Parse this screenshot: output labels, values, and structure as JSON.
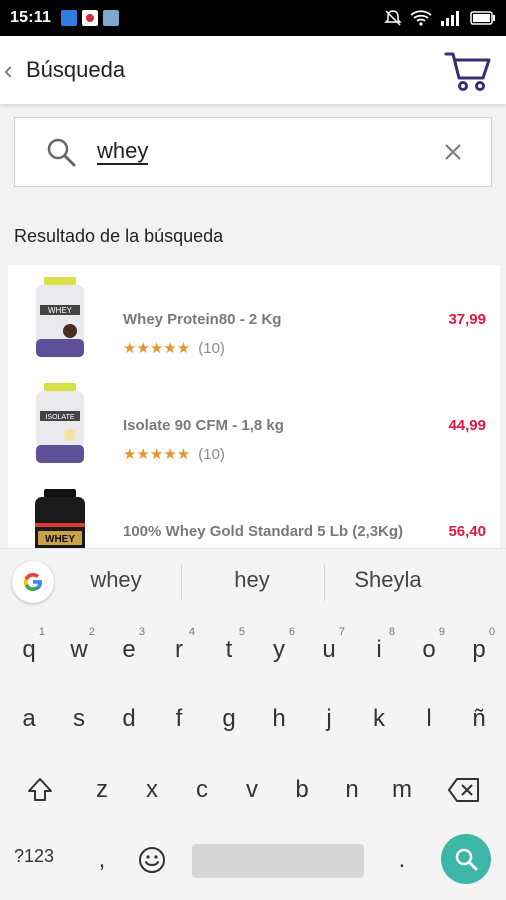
{
  "status_bar": {
    "time": "15:11"
  },
  "header": {
    "title": "Búsqueda"
  },
  "search": {
    "query": "whey"
  },
  "results": {
    "title": "Resultado de la búsqueda",
    "items": [
      {
        "name": "Whey Protein80 - 2 Kg",
        "price": "37,99",
        "stars": "★★★★★",
        "count": "(10)",
        "label": "WHEY"
      },
      {
        "name": "Isolate 90 CFM - 1,8 kg",
        "price": "44,99",
        "stars": "★★★★★",
        "count": "(10)",
        "label": "ISOLATE"
      },
      {
        "name": "100% Whey Gold Standard 5 Lb (2,3Kg)",
        "price": "56,40",
        "label": "WHEY"
      }
    ]
  },
  "suggestions": [
    "whey",
    "hey",
    "Sheyla"
  ],
  "keyboard": {
    "row1": [
      "q",
      "w",
      "e",
      "r",
      "t",
      "y",
      "u",
      "i",
      "o",
      "p"
    ],
    "row1_hints": [
      "1",
      "2",
      "3",
      "4",
      "5",
      "6",
      "7",
      "8",
      "9",
      "0"
    ],
    "row2": [
      "a",
      "s",
      "d",
      "f",
      "g",
      "h",
      "j",
      "k",
      "l",
      "ñ"
    ],
    "row3": [
      "z",
      "x",
      "c",
      "v",
      "b",
      "n",
      "m"
    ],
    "symbols": "?123",
    "comma": ",",
    "period": "."
  },
  "colors": {
    "price": "#e0173f",
    "stars": "#e5952b",
    "accent": "#3cb6a7"
  }
}
